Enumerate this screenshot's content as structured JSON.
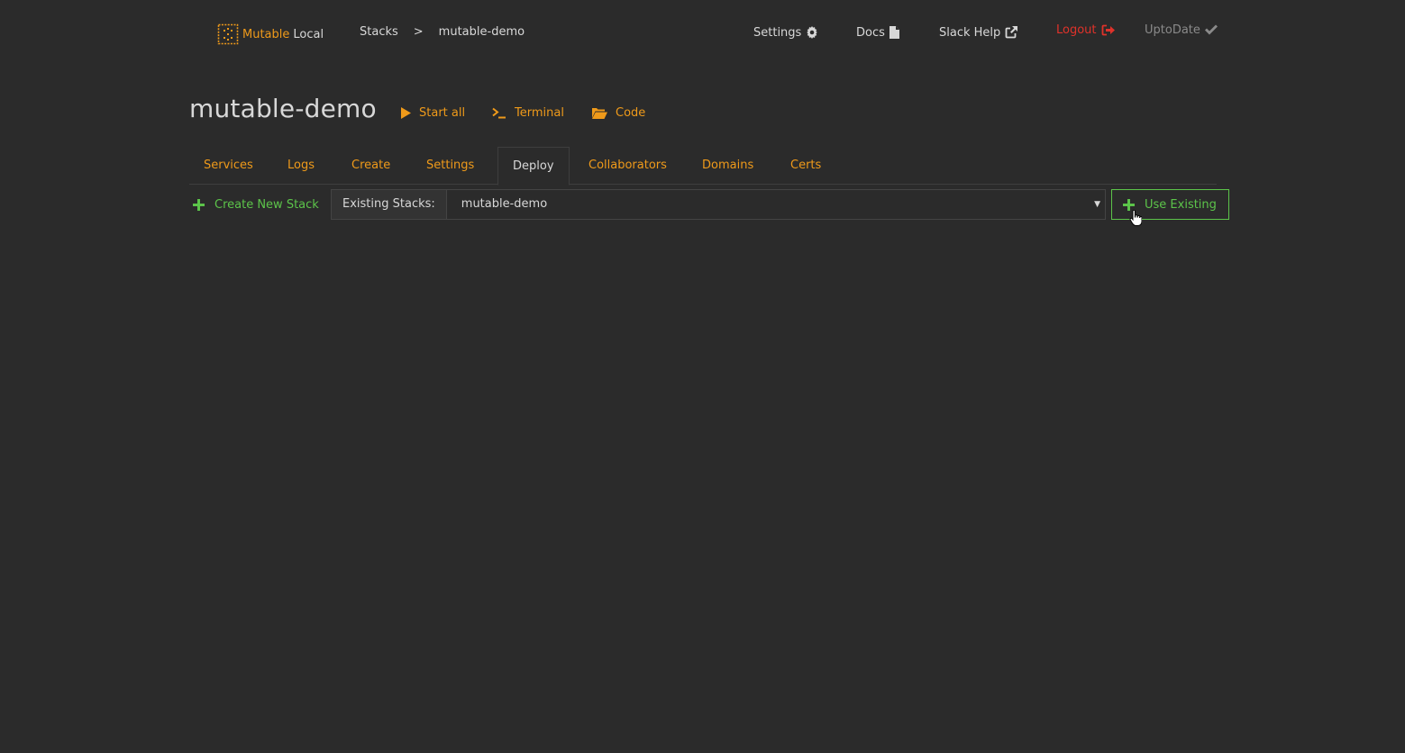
{
  "brand": {
    "name": "Mutable",
    "env": "Local"
  },
  "breadcrumb": {
    "root": "Stacks",
    "separator": ">",
    "current": "mutable-demo"
  },
  "nav": {
    "settings": "Settings",
    "docs": "Docs",
    "slack": "Slack Help",
    "logout": "Logout",
    "status": "UptoDate"
  },
  "page": {
    "title": "mutable-demo",
    "actions": {
      "start_all": "Start all",
      "terminal": "Terminal",
      "code": "Code"
    }
  },
  "tabs": [
    {
      "label": "Services"
    },
    {
      "label": "Logs"
    },
    {
      "label": "Create"
    },
    {
      "label": "Settings"
    },
    {
      "label": "Deploy",
      "active": true
    },
    {
      "label": "Collaborators"
    },
    {
      "label": "Domains"
    },
    {
      "label": "Certs"
    }
  ],
  "deploy": {
    "create_new_stack": "Create New Stack",
    "existing_label": "Existing Stacks:",
    "selected_stack": "mutable-demo",
    "use_existing": "Use Existing"
  },
  "colors": {
    "background": "#2b2b2b",
    "accent": "#ef9a1a",
    "success": "#5cc44a",
    "danger": "#e0322a",
    "muted": "#8a8a8a"
  },
  "icons": {
    "logo": "mutable-logo-icon",
    "settings": "gear-icon",
    "docs": "file-icon",
    "slack": "external-link-icon",
    "logout": "sign-out-icon",
    "status": "check-icon",
    "start_all": "play-icon",
    "terminal": "terminal-icon",
    "code": "folder-open-icon",
    "create": "plus-icon",
    "select": "caret-down-icon"
  }
}
